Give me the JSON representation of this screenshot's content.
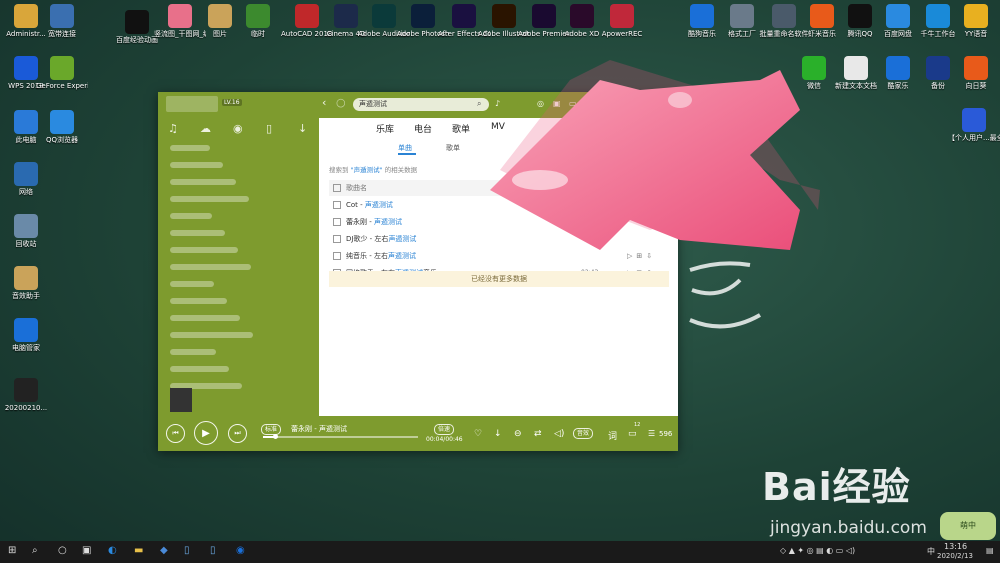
{
  "desktop_icons": [
    {
      "label": "Administr...",
      "color": "#d9a63a",
      "glyph": "folder-user-icon"
    },
    {
      "label": "宽带连接",
      "color": "#3a6fb0",
      "glyph": "network-icon"
    },
    {
      "label": "百度经验动画",
      "color": "#111",
      "glyph": "video-icon"
    },
    {
      "label": "竖流图_干图网_编号33...",
      "color": "#e8708a",
      "glyph": "image-icon"
    },
    {
      "label": "图片",
      "color": "#caa35a",
      "glyph": "folder-icon"
    },
    {
      "label": "临时",
      "color": "#3c8a2e",
      "glyph": "tree-icon"
    },
    {
      "label": "AutoCAD 2018 - 简...",
      "color": "#c0282a",
      "glyph": "autocad-icon"
    },
    {
      "label": "Cinema 4D",
      "color": "#1c2a4a",
      "glyph": "c4d-icon"
    },
    {
      "label": "Adobe Audition ...",
      "color": "#0b3a3a",
      "glyph": "au-icon"
    },
    {
      "label": "Adobe Photosh...",
      "color": "#0b1f3a",
      "glyph": "ps-icon"
    },
    {
      "label": "After Effects CC 2018",
      "color": "#1a1040",
      "glyph": "ae-icon"
    },
    {
      "label": "Adobe Illustrat...",
      "color": "#2a1400",
      "glyph": "ai-icon"
    },
    {
      "label": "Adobe Premiere P...",
      "color": "#1a0a30",
      "glyph": "pr-icon"
    },
    {
      "label": "Adobe XD",
      "color": "#2a0a2a",
      "glyph": "xd-icon"
    },
    {
      "label": "ApowerREC",
      "color": "#c0283a",
      "glyph": "record-icon"
    },
    {
      "label": "酷狗音乐",
      "color": "#1a6fd8",
      "glyph": "kugou-icon"
    },
    {
      "label": "格式工厂",
      "color": "#6a7a8a",
      "glyph": "factory-icon"
    },
    {
      "label": "批量重命名软件",
      "color": "#4a5a6a",
      "glyph": "rename-icon"
    },
    {
      "label": "虾米音乐",
      "color": "#e85a1a",
      "glyph": "xiami-icon"
    },
    {
      "label": "腾讯QQ",
      "color": "#111",
      "glyph": "qq-icon"
    },
    {
      "label": "百度网盘",
      "color": "#2a8ae0",
      "glyph": "baidu-netdisk-icon"
    },
    {
      "label": "千牛工作台",
      "color": "#1a8ad8",
      "glyph": "qianniu-icon"
    },
    {
      "label": "YY语音",
      "color": "#e8b020",
      "glyph": "yy-icon"
    },
    {
      "label": "WPS 2019",
      "color": "#1a5ad8",
      "glyph": "wps-icon"
    },
    {
      "label": "GeForce Experience",
      "color": "#6aa82a",
      "glyph": "nvidia-icon"
    },
    {
      "label": "此电脑",
      "color": "#2a7ad8",
      "glyph": "computer-icon"
    },
    {
      "label": "QQ浏览器",
      "color": "#2a8ae0",
      "glyph": "qq-browser-icon"
    },
    {
      "label": "网络",
      "color": "#2a6ab0",
      "glyph": "network-icon"
    },
    {
      "label": "回收站",
      "color": "#6a8aa8",
      "glyph": "recycle-bin-icon"
    },
    {
      "label": "音效助手",
      "color": "#caa35a",
      "glyph": "folder-icon"
    },
    {
      "label": "电脑管家",
      "color": "#1a6fd8",
      "glyph": "shield-icon"
    },
    {
      "label": "20200210...",
      "color": "#222",
      "glyph": "file-icon"
    },
    {
      "label": "微信",
      "color": "#2ab02a",
      "glyph": "wechat-icon"
    },
    {
      "label": "新建文本文档",
      "color": "#e8e8e8",
      "glyph": "text-file-icon"
    },
    {
      "label": "酷家乐",
      "color": "#1a6fd8",
      "glyph": "kujiale-icon"
    },
    {
      "label": "备份",
      "color": "#1a3a8a",
      "glyph": "backup-icon"
    },
    {
      "label": "向日葵",
      "color": "#e85a1a",
      "glyph": "sunflower-icon"
    },
    {
      "label": "【个人用户...最全艺方容...",
      "color": "#2a5ad8",
      "glyph": "word-icon"
    }
  ],
  "app": {
    "sidebar_badge": "LV.16",
    "search_text": "声遁测试",
    "tabs": [
      "乐库",
      "电台",
      "歌单",
      "MV",
      "歌词"
    ],
    "subtabs": [
      "单曲",
      "歌单"
    ],
    "note_prefix": "搜索到",
    "note_query": "\"声遁测试\"",
    "note_suffix": "的相关数据",
    "list_header": "歌曲名",
    "songs": [
      {
        "artist": "Cot - ",
        "title": "声遁测试",
        "extra": ""
      },
      {
        "artist": "蕾永刚 - ",
        "title": "声遁测试",
        "extra": ""
      },
      {
        "artist": "DJ歌少 - 左右",
        "title": "声遁测试",
        "extra": ""
      },
      {
        "artist": "纯音乐 - 左右",
        "title": "声遁测试",
        "extra": ""
      },
      {
        "artist": "网络歌手 - 左右",
        "title": "声遁测试",
        "extra": "音乐",
        "duration": "02:43"
      }
    ],
    "no_more": "已经没有更多数据",
    "player": {
      "quality": "标准",
      "now_playing": "蕾永刚 - 声遁测试",
      "time": "00:04/00:46",
      "speed": "倍速",
      "effect": "音效",
      "lyrics": "词",
      "playlist_count": "596",
      "comment_count": "12",
      "progress": 0.08
    }
  },
  "watermark": {
    "brand": "Bai经验",
    "url": "jingyan.baidu.com",
    "sticker": "萌中"
  },
  "taskbar": {
    "time": "13:16",
    "date": "2020/2/13",
    "ime": "中"
  }
}
